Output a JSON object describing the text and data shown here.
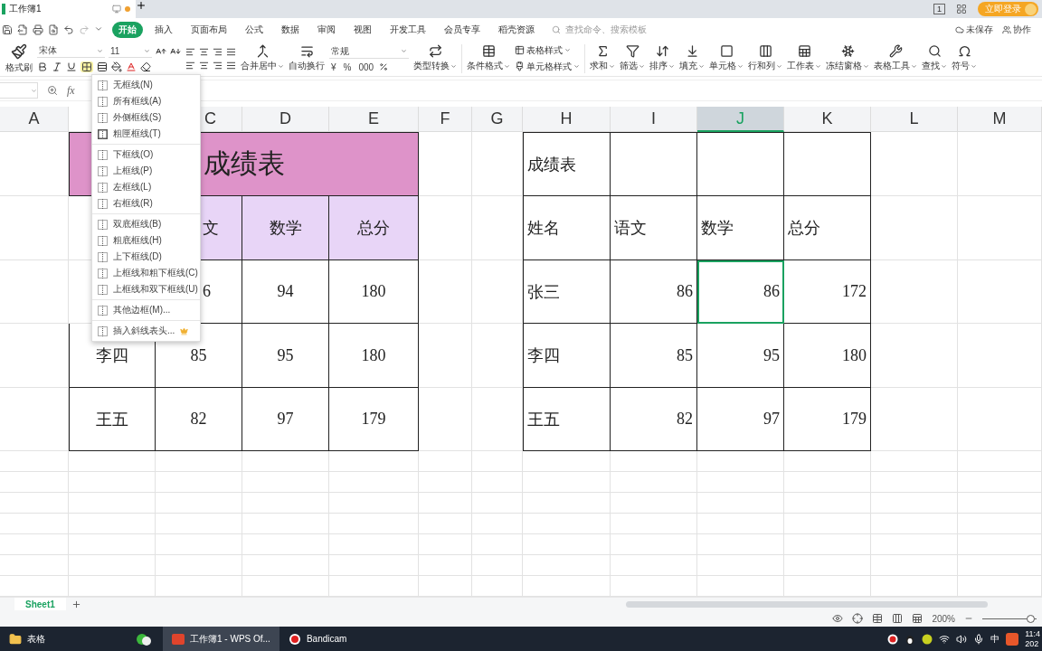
{
  "window": {
    "doc_title": "工作簿1",
    "unsaved_dot": true,
    "page_count": "1",
    "login": "立即登录"
  },
  "menu": {
    "tabs": [
      {
        "label": "开始",
        "selected": true
      },
      {
        "label": "插入",
        "selected": false
      },
      {
        "label": "页面布局",
        "selected": false
      },
      {
        "label": "公式",
        "selected": false
      },
      {
        "label": "数据",
        "selected": false
      },
      {
        "label": "审阅",
        "selected": false
      },
      {
        "label": "视图",
        "selected": false
      },
      {
        "label": "开发工具",
        "selected": false
      },
      {
        "label": "会员专享",
        "selected": false
      },
      {
        "label": "稻壳资源",
        "selected": false
      }
    ],
    "search_placeholder": "查找命令、搜索模板",
    "save_status": "未保存",
    "collaborate": "协作"
  },
  "ribbon": {
    "format_painter": "格式刷",
    "font": "宋体",
    "font_size": "11",
    "border_menu_open": true,
    "merge": "合并居中",
    "wrap": "自动换行",
    "number_format": "常规",
    "number_buttons": [
      "¥",
      "%",
      "000"
    ],
    "convert": "类型转换",
    "conditional": "条件格式",
    "styles": [
      "表格样式",
      "单元格样式"
    ],
    "tools": [
      "求和",
      "筛选",
      "排序",
      "填充",
      "单元格",
      "行和列",
      "工作表",
      "冻结窗格",
      "表格工具",
      "查找",
      "符号"
    ]
  },
  "formula_bar": {
    "fx": "fx"
  },
  "columns": [
    {
      "label": "A",
      "selected": false,
      "cut": false
    },
    {
      "label": "C",
      "selected": false,
      "cut": true
    },
    {
      "label": "D",
      "selected": false,
      "cut": false
    },
    {
      "label": "E",
      "selected": false,
      "cut": false
    },
    {
      "label": "F",
      "selected": false,
      "cut": false
    },
    {
      "label": "G",
      "selected": false,
      "cut": false
    },
    {
      "label": "H",
      "selected": false,
      "cut": false
    },
    {
      "label": "I",
      "selected": false,
      "cut": false
    },
    {
      "label": "J",
      "selected": true,
      "cut": false
    },
    {
      "label": "K",
      "selected": false,
      "cut": false
    },
    {
      "label": "L",
      "selected": false,
      "cut": false
    },
    {
      "label": "M",
      "selected": false,
      "cut": false
    }
  ],
  "left_table": {
    "title": "成绩表",
    "rows": [
      {
        "cells": [
          {
            "text": "文",
            "cut": true
          },
          {
            "text": "数学",
            "cut": false
          },
          {
            "text": "总分",
            "cut": false
          }
        ]
      },
      {
        "cells": [
          {
            "text": "6",
            "cut": true
          },
          {
            "text": "94",
            "cut": false
          },
          {
            "text": "180",
            "cut": false
          }
        ]
      },
      {
        "cells": [
          {
            "text": "李四",
            "cut": false
          },
          {
            "text": "85",
            "cut": false
          },
          {
            "text": "95",
            "cut": false
          },
          {
            "text": "180",
            "cut": false
          }
        ]
      },
      {
        "cells": [
          {
            "text": "王五",
            "cut": false
          },
          {
            "text": "82",
            "cut": false
          },
          {
            "text": "97",
            "cut": false
          },
          {
            "text": "179",
            "cut": false
          }
        ]
      }
    ]
  },
  "right_table": {
    "title": "成绩表",
    "rows": [
      [
        {
          "text": "姓名",
          "kind": "text",
          "selected": false
        },
        {
          "text": "语文",
          "kind": "text",
          "selected": false
        },
        {
          "text": "数学",
          "kind": "text",
          "selected": false
        },
        {
          "text": "总分",
          "kind": "text",
          "selected": false
        }
      ],
      [
        {
          "text": "张三",
          "kind": "text",
          "selected": false
        },
        {
          "text": "86",
          "kind": "number",
          "selected": false
        },
        {
          "text": "86",
          "kind": "number",
          "selected": true
        },
        {
          "text": "172",
          "kind": "number",
          "selected": false
        }
      ],
      [
        {
          "text": "李四",
          "kind": "text",
          "selected": false
        },
        {
          "text": "85",
          "kind": "number",
          "selected": false
        },
        {
          "text": "95",
          "kind": "number",
          "selected": false
        },
        {
          "text": "180",
          "kind": "number",
          "selected": false
        }
      ],
      [
        {
          "text": "王五",
          "kind": "text",
          "selected": false
        },
        {
          "text": "82",
          "kind": "number",
          "selected": false
        },
        {
          "text": "97",
          "kind": "number",
          "selected": false
        },
        {
          "text": "179",
          "kind": "number",
          "selected": false
        }
      ]
    ]
  },
  "border_menu": {
    "groups": [
      [
        {
          "label": "无框线(N)",
          "premium": false
        },
        {
          "label": "所有框线(A)",
          "premium": false
        },
        {
          "label": "外侧框线(S)",
          "premium": false
        },
        {
          "label": "粗匣框线(T)",
          "premium": false
        }
      ],
      [
        {
          "label": "下框线(O)",
          "premium": false
        },
        {
          "label": "上框线(P)",
          "premium": false
        },
        {
          "label": "左框线(L)",
          "premium": false
        },
        {
          "label": "右框线(R)",
          "premium": false
        }
      ],
      [
        {
          "label": "双底框线(B)",
          "premium": false
        },
        {
          "label": "粗底框线(H)",
          "premium": false
        },
        {
          "label": "上下框线(D)",
          "premium": false
        },
        {
          "label": "上框线和粗下框线(C)",
          "premium": false
        },
        {
          "label": "上框线和双下框线(U)",
          "premium": false
        }
      ],
      [
        {
          "label": "其他边框(M)...",
          "premium": false
        }
      ],
      [
        {
          "label": "插入斜线表头...",
          "premium": true
        }
      ]
    ]
  },
  "sheet_tabs": [
    {
      "label": "Sheet1",
      "selected": true
    }
  ],
  "status_bar": {
    "zoom": "200%",
    "zoom_slider": {
      "level": 0.9
    }
  },
  "taskbar": {
    "items": [
      {
        "label": "表格",
        "selected": false
      },
      {
        "label": "工作簿1 - WPS Of...",
        "selected": true
      },
      {
        "label": "Bandicam",
        "selected": false
      }
    ],
    "ime": "中",
    "clock": [
      "11:4",
      "202"
    ]
  }
}
